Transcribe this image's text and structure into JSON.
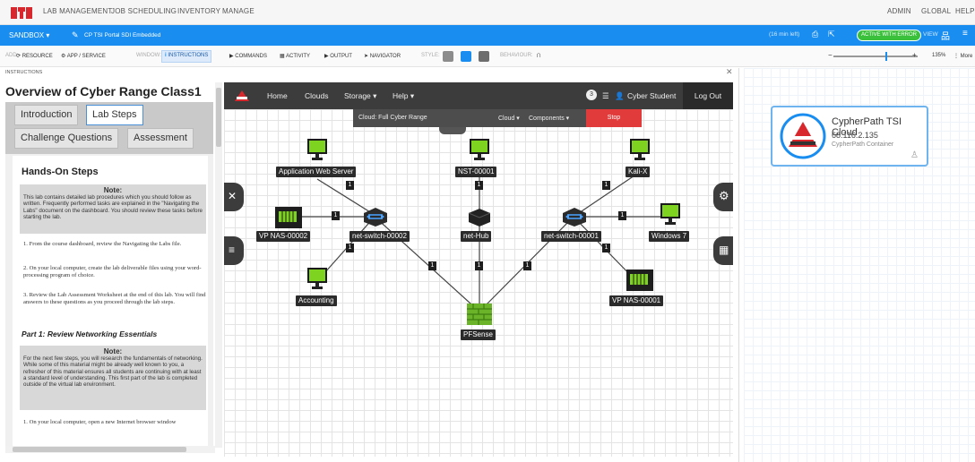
{
  "topnav": {
    "items": [
      "LAB MANAGEMENT",
      "JOB SCHEDULING",
      "INVENTORY",
      "MANAGE"
    ],
    "right_items": [
      "ADMIN",
      "GLOBAL",
      "HELP"
    ]
  },
  "bluebar": {
    "sandbox": "SANDBOX",
    "sandbox_name": "CP TSI Portal SDI Embedded",
    "time_left": "(16 min left)",
    "status_pill": "ACTIVE WITH ERROR",
    "view_label": "VIEW"
  },
  "toolbar": {
    "add_label": "ADD:",
    "resource": "RESOURCE",
    "app_service": "APP / SERVICE",
    "window_label": "WINDOW:",
    "instructions": "INSTRUCTIONS",
    "commands": "COMMANDS",
    "activity": "ACTIVITY",
    "output": "OUTPUT",
    "navigator": "NAVIGATOR",
    "style_label": "STYLE:",
    "behaviour_label": "BEHAVIOUR:",
    "zoom": "135%",
    "more": "More"
  },
  "instructions_panel": {
    "header": "INSTRUCTIONS",
    "title": "Overview of Cyber Range Class1",
    "tabs": [
      "Introduction",
      "Lab Steps",
      "Challenge Questions",
      "Assessment"
    ],
    "active_tab": "Lab Steps",
    "section_title": "Hands-On Steps",
    "note1_title": "Note:",
    "note1_text": "This lab contains detailed lab procedures which you should follow as written. Frequently performed tasks are explained in the \"Navigating the Labs\" document on the dashboard. You should review these tasks before starting the lab.",
    "steps": [
      "1. From the course dashboard, review the Navigating the Labs file.",
      "2. On your local computer, create the lab deliverable files using your word-processing program of choice.",
      "3. Review the Lab Assessment Worksheet at the end of this lab. You will find answers to these questions as you proceed through the lab steps."
    ],
    "part1_title": "Part 1: Review Networking Essentials",
    "note2_title": "Note:",
    "note2_text": "For the next few steps, you will research the fundamentals of networking. While some of this material might be already well known to you, a refresher of this material ensures all students are continuing with at least a standard level of understanding. This first part of the lab is completed outside of the virtual lab environment.",
    "step_last": "1. On your local computer, open a new Internet browser window"
  },
  "range_app": {
    "nav": [
      "Home",
      "Clouds",
      "Storage ▾",
      "Help ▾"
    ],
    "notif_count": "3",
    "user": "Cyber Student",
    "logout": "Log Out",
    "cloud_label": "Cloud: Full Cyber Range",
    "cloud_menu": "Cloud ▾",
    "components_menu": "Components ▾",
    "stop": "Stop",
    "nodes": {
      "app_web_server": "Application Web Server",
      "nst": "NST-00001",
      "kali": "Kali-X",
      "vp_nas_2": "VP NAS-00002",
      "switch_2": "net-switch-00002",
      "hub": "net-Hub",
      "switch_1": "net-switch-00001",
      "windows7": "Windows 7",
      "accounting": "Accounting",
      "vp_nas_1": "VP NAS-00001",
      "pfsense": "PFSense"
    },
    "link_badge": "1"
  },
  "canvas": {
    "card_title": "CypherPath TSI Cloud",
    "card_ip": "68.116.2.135",
    "card_sub": "CypherPath Container"
  },
  "colors": {
    "accent_blue": "#1a8ef0",
    "stop_red": "#e23b3b",
    "status_green": "#3ac03a",
    "brand_red": "#d8272d"
  }
}
